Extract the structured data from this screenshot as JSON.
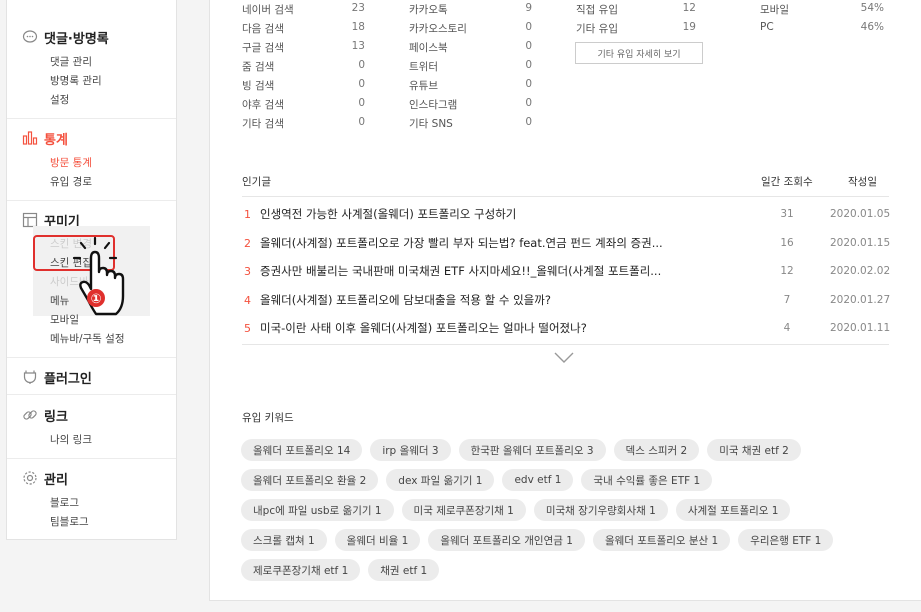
{
  "sidebar": {
    "sections": [
      {
        "icon": "comment-icon",
        "label": "댓글·방명록",
        "items": [
          "댓글 관리",
          "방명록 관리",
          "설정"
        ]
      },
      {
        "icon": "chart-icon",
        "label": "통계",
        "items": [
          "방문 통계",
          "유입 경로"
        ]
      },
      {
        "icon": "decorate-icon",
        "label": "꾸미기",
        "items": [
          "스킨 변경",
          "스킨 편집",
          "사이드바",
          "메뉴",
          "모바일",
          "메뉴바/구독 설정"
        ]
      },
      {
        "icon": "plugin-icon",
        "label": "플러그인",
        "items": []
      },
      {
        "icon": "link-icon",
        "label": "링크",
        "items": [
          "나의 링크"
        ]
      },
      {
        "icon": "gear-icon",
        "label": "관리",
        "items": [
          "블로그",
          "팀블로그"
        ]
      }
    ],
    "callout_number": "①"
  },
  "referrers": {
    "search": [
      {
        "name": "네이버 검색",
        "count": "23"
      },
      {
        "name": "다음 검색",
        "count": "18"
      },
      {
        "name": "구글 검색",
        "count": "13"
      },
      {
        "name": "줌 검색",
        "count": "0"
      },
      {
        "name": "빙 검색",
        "count": "0"
      },
      {
        "name": "야후 검색",
        "count": "0"
      },
      {
        "name": "기타 검색",
        "count": "0"
      }
    ],
    "social": [
      {
        "name": "카카오톡",
        "count": "9"
      },
      {
        "name": "카카오스토리",
        "count": "0"
      },
      {
        "name": "페이스북",
        "count": "0"
      },
      {
        "name": "트위터",
        "count": "0"
      },
      {
        "name": "유튜브",
        "count": "0"
      },
      {
        "name": "인스타그램",
        "count": "0"
      },
      {
        "name": "기타 SNS",
        "count": "0"
      }
    ],
    "direct": [
      {
        "name": "직접 유입",
        "count": "12"
      },
      {
        "name": "기타 유입",
        "count": "19"
      }
    ],
    "device": [
      {
        "name": "모바일",
        "count": "54%"
      },
      {
        "name": "PC",
        "count": "46%"
      }
    ],
    "detail_button": "기타 유입 자세히 보기"
  },
  "popular": {
    "header_title": "인기글",
    "header_views": "일간 조회수",
    "header_date": "작성일",
    "posts": [
      {
        "rank": "1",
        "title": "인생역전 가능한 사계절(올웨더) 포트폴리오 구성하기",
        "views": "31",
        "date": "2020.01.05"
      },
      {
        "rank": "2",
        "title": "올웨더(사계절) 포트폴리오로 가장 빨리 부자 되는법? feat.연금 펀드 계좌의 증권...",
        "views": "16",
        "date": "2020.01.15"
      },
      {
        "rank": "3",
        "title": "증권사만 배불리는 국내판매 미국채권 ETF 사지마세요!!_올웨더(사계절 포트폴리...",
        "views": "12",
        "date": "2020.02.02"
      },
      {
        "rank": "4",
        "title": "올웨더(사계절) 포트폴리오에 담보대출을 적용 할 수 있을까?",
        "views": "7",
        "date": "2020.01.27"
      },
      {
        "rank": "5",
        "title": "미국-이란 사태 이후 올웨더(사계절) 포트폴리오는 얼마나 떨어졌나?",
        "views": "4",
        "date": "2020.01.11"
      }
    ]
  },
  "keywords": {
    "title": "유입 키워드",
    "tags": [
      "올웨더 포트폴리오 14",
      "irp 올웨더 3",
      "한국판 올웨더 포트폴리오 3",
      "덱스 스피커 2",
      "미국 채권 etf 2",
      "올웨더 포트폴리오 환율 2",
      "dex 파일 옮기기 1",
      "edv etf 1",
      "국내 수익률 좋은 ETF 1",
      "내pc에 파일 usb로 옮기기 1",
      "미국 제로쿠폰장기채 1",
      "미국채 장기우량회사채 1",
      "사계절 포트폴리오 1",
      "스크롤 캡쳐 1",
      "올웨더 비율 1",
      "올웨더 포트폴리오 개인연금 1",
      "올웨더 포트폴리오 분산 1",
      "우리은행 ETF 1",
      "제로쿠폰장기채 etf 1",
      "채권 etf 1"
    ]
  }
}
